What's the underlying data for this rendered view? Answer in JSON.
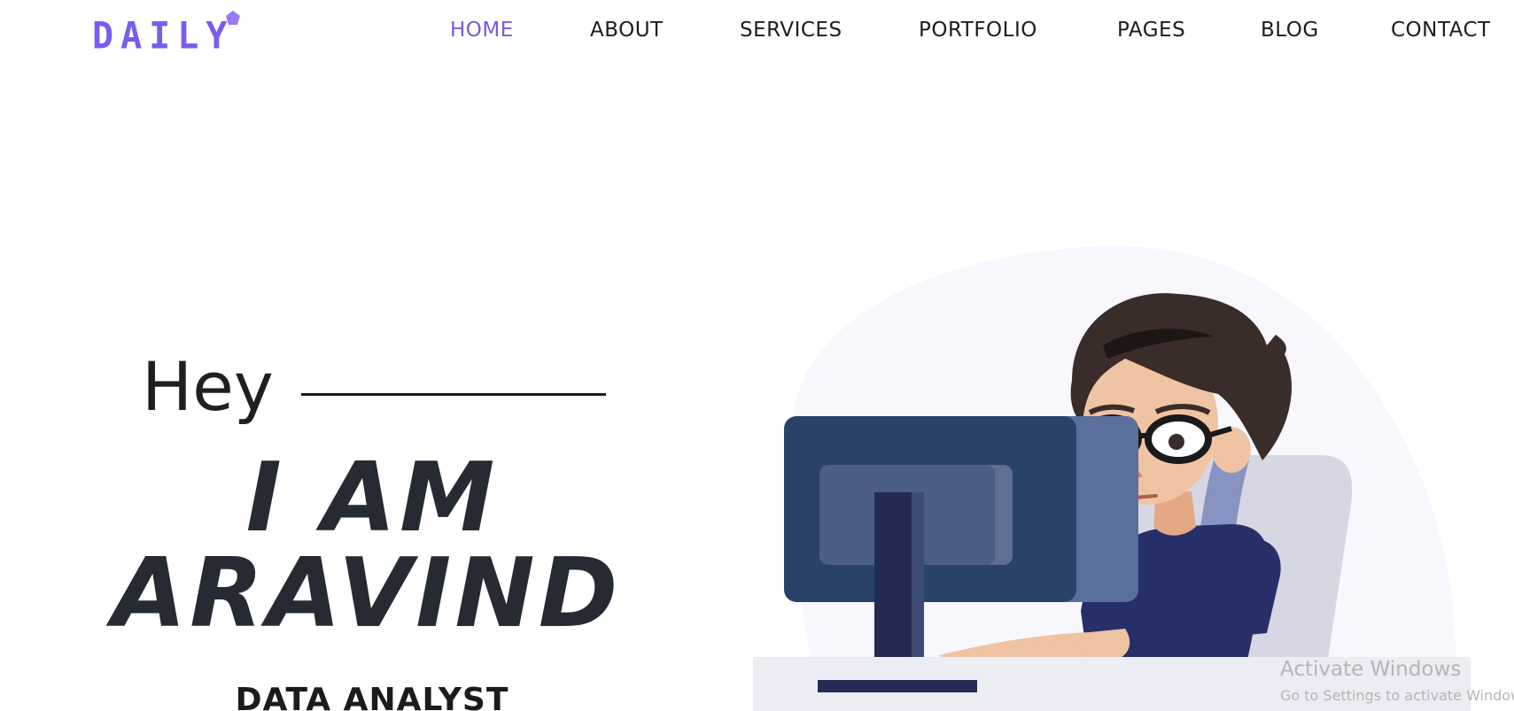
{
  "header": {
    "logo_text": "DAILY",
    "nav": [
      {
        "label": "HOME",
        "active": true
      },
      {
        "label": "ABOUT",
        "active": false
      },
      {
        "label": "SERVICES",
        "active": false
      },
      {
        "label": "PORTFOLIO",
        "active": false
      },
      {
        "label": "PAGES",
        "active": false
      },
      {
        "label": "BLOG",
        "active": false
      },
      {
        "label": "CONTACT",
        "active": false
      }
    ]
  },
  "hero": {
    "greeting": "Hey",
    "headline_line1": "I AM",
    "headline_line2": "ARAVIND",
    "role": "DATA ANALYST",
    "illustration_icon": "man-at-computer-illustration"
  },
  "watermark": {
    "title": "Activate Windows",
    "subtitle": "Go to Settings to activate Windows."
  },
  "colors": {
    "accent": "#6f5fe0",
    "logo": "#7a5cf0",
    "headline": "#262b33",
    "blob": "#f7f7fd",
    "monitor": "#2a4269",
    "shirt": "#262f68",
    "chair": "#d6d7e3"
  }
}
